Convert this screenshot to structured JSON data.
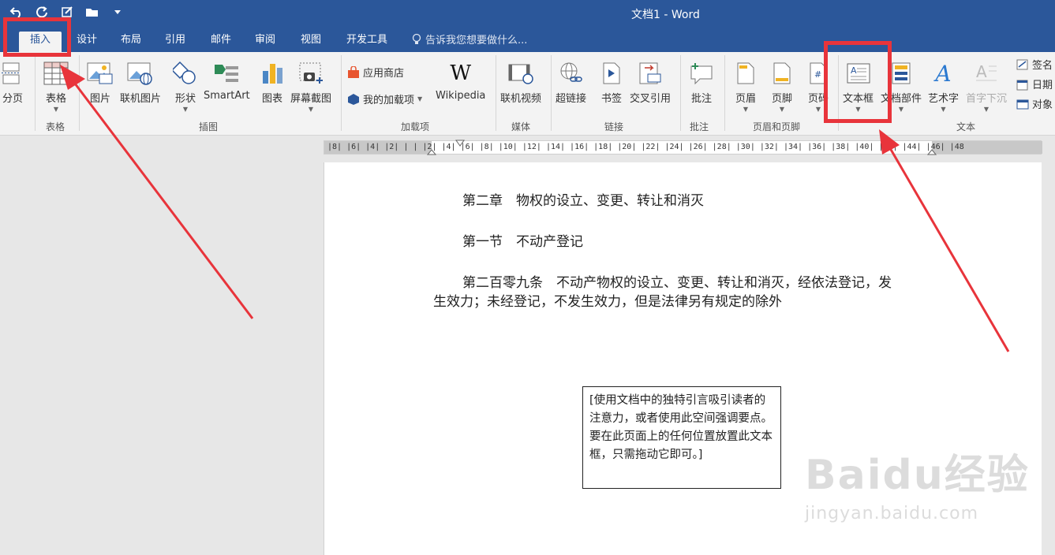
{
  "window": {
    "title": "文档1 - Word"
  },
  "tabs": [
    {
      "label": "插入",
      "active": true
    },
    {
      "label": "设计"
    },
    {
      "label": "布局"
    },
    {
      "label": "引用"
    },
    {
      "label": "邮件"
    },
    {
      "label": "审阅"
    },
    {
      "label": "视图"
    },
    {
      "label": "开发工具"
    }
  ],
  "tell_me": "告诉我您想要做什么...",
  "ribbon": {
    "pages_partial": "分页",
    "table": "表格",
    "picture": "图片",
    "online_picture": "联机图片",
    "shapes": "形状",
    "smartart": "SmartArt",
    "chart": "图表",
    "screenshot": "屏幕截图",
    "store": "应用商店",
    "my_addins": "我的加载项",
    "wikipedia": "Wikipedia",
    "online_video": "联机视频",
    "link": "超链接",
    "bookmark": "书签",
    "cross_ref": "交叉引用",
    "comment": "批注",
    "header": "页眉",
    "footer": "页脚",
    "page_number": "页码",
    "text_box": "文本框",
    "quick_parts": "文档部件",
    "wordart": "艺术字",
    "drop_cap": "首字下沉",
    "signature": "签名",
    "date": "日期",
    "object": "对象",
    "groups": {
      "tables": "表格",
      "illustrations": "插图",
      "addins": "加载项",
      "media": "媒体",
      "links": "链接",
      "comments": "批注",
      "header_footer": "页眉和页脚",
      "text": "文本"
    }
  },
  "ruler": {
    "labels": "|8| |6| |4| |2| | | |2| |4| |6| |8| |10| |12| |14| |16| |18| |20| |22| |24| |26| |28| |30| |32| |34| |36| |38| |40| |42| |44| |46| |48"
  },
  "document": {
    "chapter": "第二章　物权的设立、变更、转让和消灭",
    "section": "第一节　不动产登记",
    "article_line1": "第二百零九条　不动产物权的设立、变更、转让和消灭，经依法登记，发",
    "article_line2": "生效力；未经登记，不发生效力，但是法律另有规定的除外",
    "textbox": "[使用文档中的独特引言吸引读者的注意力，或者使用此空间强调要点。要在此页面上的任何位置放置此文本框，只需拖动它即可。]"
  },
  "watermark": {
    "logo": "Baidu经验",
    "url": "jingyan.baidu.com"
  },
  "colors": {
    "ribbon_blue": "#2b579a",
    "annotation_red": "#e8343b"
  }
}
